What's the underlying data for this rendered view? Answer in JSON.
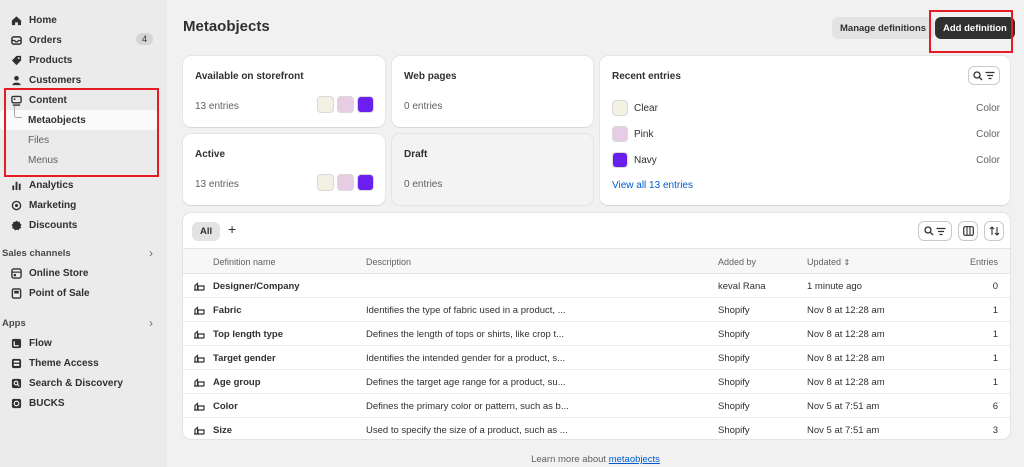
{
  "sidebar": {
    "items": [
      {
        "label": "Home",
        "icon": "home-icon"
      },
      {
        "label": "Orders",
        "icon": "orders-icon",
        "badge": "4"
      },
      {
        "label": "Products",
        "icon": "tag-icon"
      },
      {
        "label": "Customers",
        "icon": "person-icon"
      },
      {
        "label": "Content",
        "icon": "content-icon"
      }
    ],
    "content_sub": [
      {
        "label": "Metaobjects",
        "active": true
      },
      {
        "label": "Files"
      },
      {
        "label": "Menus"
      }
    ],
    "items2": [
      {
        "label": "Analytics",
        "icon": "bar-chart-icon"
      },
      {
        "label": "Marketing",
        "icon": "target-icon"
      },
      {
        "label": "Discounts",
        "icon": "discount-icon"
      }
    ],
    "sales_channels_label": "Sales channels",
    "sales_channels": [
      {
        "label": "Online Store",
        "icon": "store-icon"
      },
      {
        "label": "Point of Sale",
        "icon": "pos-icon"
      }
    ],
    "apps_label": "Apps",
    "apps": [
      {
        "label": "Flow",
        "icon": "flow-icon"
      },
      {
        "label": "Theme Access",
        "icon": "theme-access-icon"
      },
      {
        "label": "Search & Discovery",
        "icon": "search-discovery-icon"
      },
      {
        "label": "BUCKS",
        "icon": "bucks-icon"
      }
    ]
  },
  "header": {
    "title": "Metaobjects",
    "manage_label": "Manage definitions",
    "add_label": "Add definition"
  },
  "cards": {
    "storefront": {
      "title": "Available on storefront",
      "count": "13 entries"
    },
    "webpages": {
      "title": "Web pages",
      "count": "0 entries"
    },
    "active": {
      "title": "Active",
      "count": "13 entries"
    },
    "draft": {
      "title": "Draft",
      "count": "0 entries"
    }
  },
  "swatch_colors": [
    "#f3f1e3",
    "#e7cde4",
    "#6a1ff0"
  ],
  "recent": {
    "title": "Recent entries",
    "entries": [
      {
        "name": "Clear",
        "type": "Color",
        "color": "#f3f1e3"
      },
      {
        "name": "Pink",
        "type": "Color",
        "color": "#e7cde4"
      },
      {
        "name": "Navy",
        "type": "Color",
        "color": "#6a1ff0"
      }
    ],
    "view_all": "View all 13 entries"
  },
  "table": {
    "tab_all": "All",
    "tab_add": "+",
    "headers": {
      "name": "Definition name",
      "description": "Description",
      "added_by": "Added by",
      "updated": "Updated",
      "entries": "Entries"
    },
    "rows": [
      {
        "name": "Designer/Company",
        "description": "",
        "added_by": "keval Rana",
        "updated": "1 minute ago",
        "entries": "0"
      },
      {
        "name": "Fabric",
        "description": "Identifies the type of fabric used in a product, ...",
        "added_by": "Shopify",
        "updated": "Nov 8 at 12:28 am",
        "entries": "1"
      },
      {
        "name": "Top length type",
        "description": "Defines the length of tops or shirts, like crop t...",
        "added_by": "Shopify",
        "updated": "Nov 8 at 12:28 am",
        "entries": "1"
      },
      {
        "name": "Target gender",
        "description": "Identifies the intended gender for a product, s...",
        "added_by": "Shopify",
        "updated": "Nov 8 at 12:28 am",
        "entries": "1"
      },
      {
        "name": "Age group",
        "description": "Defines the target age range for a product, su...",
        "added_by": "Shopify",
        "updated": "Nov 8 at 12:28 am",
        "entries": "1"
      },
      {
        "name": "Color",
        "description": "Defines the primary color or pattern, such as b...",
        "added_by": "Shopify",
        "updated": "Nov 5 at 7:51 am",
        "entries": "6"
      },
      {
        "name": "Size",
        "description": "Used to specify the size of a product, such as ...",
        "added_by": "Shopify",
        "updated": "Nov 5 at 7:51 am",
        "entries": "3"
      }
    ]
  },
  "footer": {
    "text": "Learn more about",
    "link": "metaobjects"
  }
}
